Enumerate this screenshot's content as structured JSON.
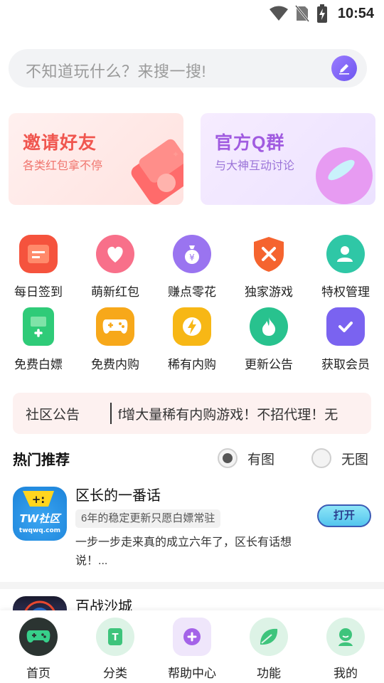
{
  "status_bar": {
    "time": "10:54"
  },
  "search": {
    "placeholder": "不知道玩什么？来搜一搜!"
  },
  "banners": [
    {
      "title": "邀请好友",
      "subtitle": "各类红包拿不停"
    },
    {
      "title": "官方Q群",
      "subtitle": "与大神互动讨论"
    }
  ],
  "grid": [
    {
      "label": "每日签到",
      "icon": "calendar-icon",
      "color": "#f5533d"
    },
    {
      "label": "萌新红包",
      "icon": "heart-icon",
      "color": "#f8708a"
    },
    {
      "label": "赚点零花",
      "icon": "money-bag-icon",
      "color": "#9a74f0"
    },
    {
      "label": "独家游戏",
      "icon": "shield-icon",
      "color": "#f5642f"
    },
    {
      "label": "特权管理",
      "icon": "user-card-icon",
      "color": "#2fc7a6"
    },
    {
      "label": "免费白嫖",
      "icon": "phone-plus-icon",
      "color": "#2fcb78"
    },
    {
      "label": "免费内购",
      "icon": "gamepad-icon",
      "color": "#f7a81a"
    },
    {
      "label": "稀有内购",
      "icon": "lightning-icon",
      "color": "#f7b715"
    },
    {
      "label": "更新公告",
      "icon": "flame-icon",
      "color": "#28c28e"
    },
    {
      "label": "获取会员",
      "icon": "check-badge-icon",
      "color": "#7a63f0"
    }
  ],
  "notice": {
    "label": "社区公告",
    "text": "f增大量稀有内购游戏！不招代理！无"
  },
  "section": {
    "title": "热门推荐",
    "option_with_image": "有图",
    "option_no_image": "无图",
    "selected": "有图"
  },
  "list": [
    {
      "title": "区长的一番话",
      "tag": "6年的稳定更新只愿白嫖常驻",
      "desc": "一步一步走来真的成立六年了，区长有话想说！...",
      "button": "打开",
      "logo_text": "TW社区",
      "logo_sub": "twqwq.com"
    },
    {
      "title": "百战沙城"
    }
  ],
  "nav": [
    {
      "label": "首页",
      "icon": "gamepad-home-icon"
    },
    {
      "label": "分类",
      "icon": "category-t-icon"
    },
    {
      "label": "帮助中心",
      "icon": "plus-help-icon"
    },
    {
      "label": "功能",
      "icon": "leaf-icon"
    },
    {
      "label": "我的",
      "icon": "profile-icon"
    }
  ]
}
